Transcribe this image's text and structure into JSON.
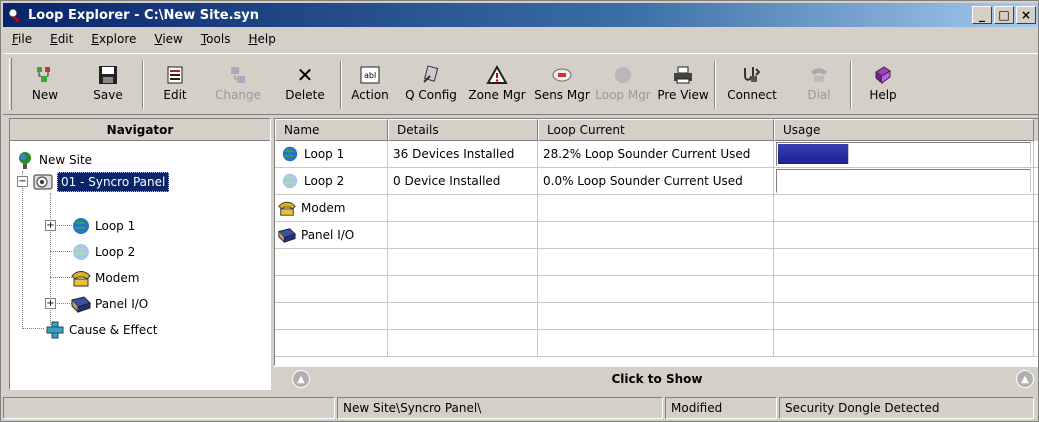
{
  "window": {
    "title": "Loop Explorer - C:\\New Site.syn"
  },
  "menu": [
    "File",
    "Edit",
    "Explore",
    "View",
    "Tools",
    "Help"
  ],
  "toolbar": [
    {
      "label": "New",
      "icon": "new-site-icon",
      "enabled": true
    },
    {
      "label": "Save",
      "icon": "floppy-disk-icon",
      "enabled": true
    },
    {
      "label": "Edit",
      "icon": "edit-form-icon",
      "enabled": true
    },
    {
      "label": "Change",
      "icon": "change-icon",
      "enabled": false
    },
    {
      "label": "Delete",
      "icon": "delete-x-icon",
      "enabled": true
    },
    {
      "label": "Action",
      "icon": "action-textbox-icon",
      "enabled": true
    },
    {
      "label": "Q Config",
      "icon": "quick-config-icon",
      "enabled": true
    },
    {
      "label": "Zone Mgr",
      "icon": "zone-warning-icon",
      "enabled": true
    },
    {
      "label": "Sens Mgr",
      "icon": "sensor-icon",
      "enabled": true
    },
    {
      "label": "Loop Mgr",
      "icon": "loop-manager-icon",
      "enabled": false
    },
    {
      "label": "Pre View",
      "icon": "printer-icon",
      "enabled": true
    },
    {
      "label": "Connect",
      "icon": "connect-icon",
      "enabled": true
    },
    {
      "label": "Dial",
      "icon": "dial-icon",
      "enabled": false
    },
    {
      "label": "Help",
      "icon": "help-book-icon",
      "enabled": true
    }
  ],
  "navigator": {
    "title": "Navigator",
    "items": [
      {
        "label": "New Site",
        "icon": "site-globe-icon"
      },
      {
        "label": "01 - Syncro Panel",
        "icon": "panel-icon",
        "selected": true
      },
      {
        "label": "Loop 1",
        "icon": "loop-globe-icon"
      },
      {
        "label": "Loop 2",
        "icon": "loop-globe-faded-icon"
      },
      {
        "label": "Modem",
        "icon": "modem-icon"
      },
      {
        "label": "Panel I/O",
        "icon": "panel-io-icon"
      },
      {
        "label": "Cause & Effect",
        "icon": "cause-effect-icon"
      }
    ]
  },
  "grid": {
    "columns": [
      "Name",
      "Details",
      "Loop Current",
      "Usage"
    ],
    "rows": [
      {
        "name": "Loop 1",
        "details": "36 Devices Installed",
        "current": "28.2% Loop Sounder Current Used",
        "usage": 0.282
      },
      {
        "name": "Loop 2",
        "details": "0 Device Installed",
        "current": "0.0% Loop Sounder Current Used",
        "usage": 0.0
      },
      {
        "name": "Modem",
        "details": "",
        "current": ""
      },
      {
        "name": "Panel I/O",
        "details": "",
        "current": ""
      }
    ]
  },
  "click_bar": {
    "label": "Click to Show"
  },
  "status": [
    "",
    "New Site\\Syncro Panel\\",
    "Modified",
    "Security Dongle Detected"
  ],
  "colors": {
    "selection": "#0a246a",
    "usage_bar": "#2a30a0",
    "title_start": "#0a246a"
  }
}
